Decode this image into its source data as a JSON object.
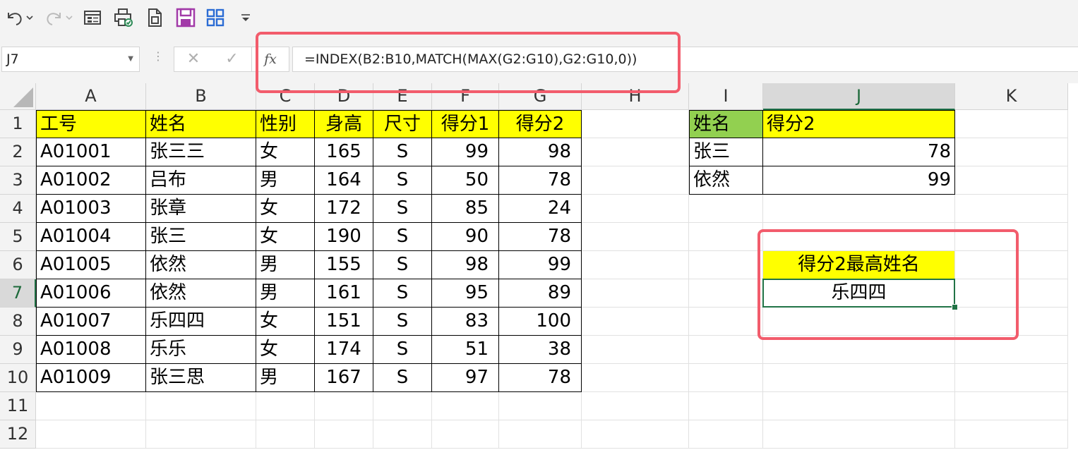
{
  "toolbar": {
    "buttons": [
      {
        "icon": "undo-icon"
      },
      {
        "icon": "redo-icon"
      },
      {
        "icon": "form-icon"
      },
      {
        "icon": "print-preview-icon"
      },
      {
        "icon": "document-icon"
      },
      {
        "icon": "save-icon"
      },
      {
        "icon": "grid-apps-icon"
      },
      {
        "icon": "customize-toolbar-icon"
      }
    ]
  },
  "formula_bar": {
    "name_box": "J7",
    "fx_label": "fx",
    "cancel": "✕",
    "enter": "✓",
    "formula": "=INDEX(B2:B10,MATCH(MAX(G2:G10),G2:G10,0))"
  },
  "columns": [
    "A",
    "B",
    "C",
    "D",
    "E",
    "F",
    "G",
    "H",
    "I",
    "J",
    "K"
  ],
  "rows": [
    "1",
    "2",
    "3",
    "4",
    "5",
    "6",
    "7",
    "8",
    "9",
    "10",
    "11",
    "12"
  ],
  "table": {
    "headers": [
      "工号",
      "姓名",
      "性别",
      "身高",
      "尺寸",
      "得分1",
      "得分2"
    ],
    "rows": [
      [
        "A01001",
        "张三三",
        "女",
        "165",
        "S",
        "99",
        "98"
      ],
      [
        "A01002",
        "吕布",
        "男",
        "164",
        "S",
        "50",
        "78"
      ],
      [
        "A01003",
        "张章",
        "女",
        "172",
        "S",
        "85",
        "24"
      ],
      [
        "A01004",
        "张三",
        "女",
        "190",
        "S",
        "90",
        "78"
      ],
      [
        "A01005",
        "依然",
        "男",
        "155",
        "S",
        "98",
        "99"
      ],
      [
        "A01006",
        "依然",
        "男",
        "161",
        "S",
        "95",
        "89"
      ],
      [
        "A01007",
        "乐四四",
        "女",
        "151",
        "S",
        "83",
        "100"
      ],
      [
        "A01008",
        "乐乐",
        "女",
        "174",
        "S",
        "51",
        "38"
      ],
      [
        "A01009",
        "张三思",
        "男",
        "167",
        "S",
        "97",
        "78"
      ]
    ]
  },
  "lookup": {
    "headers": [
      "姓名",
      "得分2"
    ],
    "rows": [
      [
        "张三",
        "78"
      ],
      [
        "依然",
        "99"
      ]
    ]
  },
  "result": {
    "label": "得分2最高姓名",
    "value": "乐四四"
  },
  "colors": {
    "header_yellow": "#ffff00",
    "header_green": "#92d050",
    "selection_green": "#217346",
    "highlight_red": "#f25c6c"
  }
}
